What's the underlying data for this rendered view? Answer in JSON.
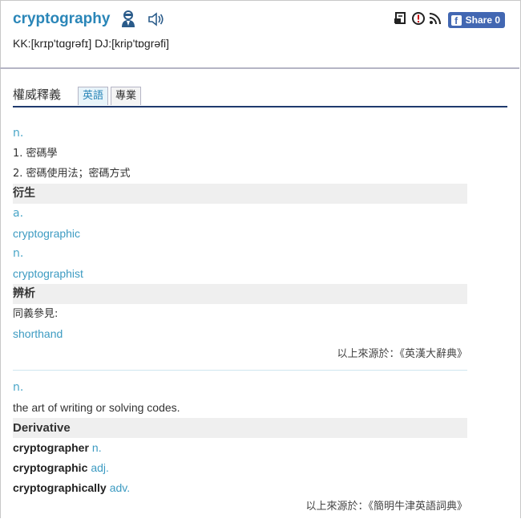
{
  "entry": {
    "word": "cryptography",
    "phonetic": "KK:[krɪp'tɑgrəfɪ] DJ:[krip'tɒgrəfi]",
    "icons": [
      "person-speaker-icon",
      "speaker-icon"
    ]
  },
  "toolbar": {
    "icons": [
      "bookmark-icon",
      "report-icon",
      "rss-icon"
    ],
    "share_label": "Share 0"
  },
  "tabs": {
    "section_title": "權威釋義",
    "items": [
      "英語",
      "專業"
    ],
    "active": "英語"
  },
  "block1": {
    "pos": "n.",
    "defs": [
      "1. 密碼學",
      "2. 密碼使用法；密碼方式"
    ],
    "derived_title": "衍生",
    "derived": [
      {
        "pos": "a.",
        "word": "cryptographic"
      },
      {
        "pos": "n.",
        "word": "cryptographist"
      }
    ],
    "analysis_title": "辨析",
    "synonym_label": "同義參見:",
    "synonym": "shorthand",
    "source": "以上來源於：《英漢大辭典》"
  },
  "block2": {
    "pos": "n.",
    "def": "the art of writing or solving codes.",
    "derivative_title": "Derivative",
    "derivatives": [
      {
        "word": "cryptographer",
        "pos": "n."
      },
      {
        "word": "cryptographic",
        "pos": "adj."
      },
      {
        "word": "cryptographically",
        "pos": "adv."
      }
    ],
    "source": "以上來源於：《簡明牛津英語詞典》"
  },
  "colors": {
    "link": "#2a86b8",
    "tab_border": "#1f3a6e",
    "facebook": "#4267b2"
  }
}
